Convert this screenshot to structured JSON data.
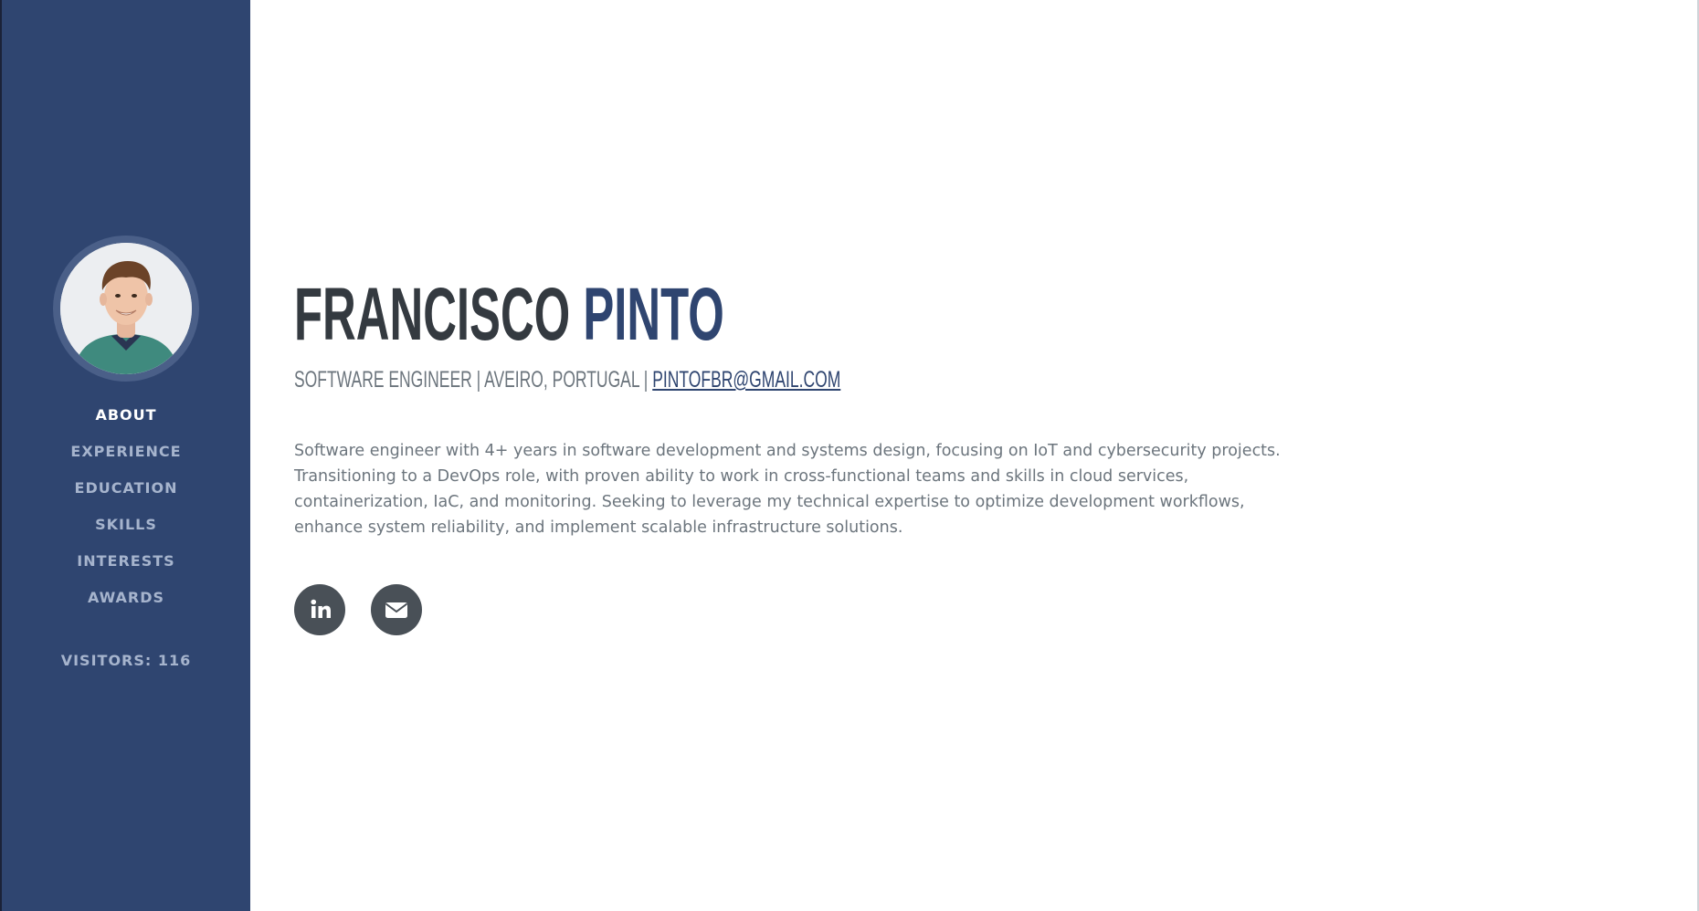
{
  "colors": {
    "sidebar_bg": "#2f4570",
    "primary": "#2f4570",
    "heading": "#343a40",
    "muted_text": "#6c757d",
    "nav_text": "#a6b4cd",
    "nav_active": "#ffffff",
    "social_bg": "#495057"
  },
  "sidebar": {
    "avatar_alt": "profile-photo",
    "nav": [
      {
        "label": "ABOUT",
        "active": true
      },
      {
        "label": "EXPERIENCE",
        "active": false
      },
      {
        "label": "EDUCATION",
        "active": false
      },
      {
        "label": "SKILLS",
        "active": false
      },
      {
        "label": "INTERESTS",
        "active": false
      },
      {
        "label": "AWARDS",
        "active": false
      }
    ],
    "visitors": "VISITORS: 116"
  },
  "about": {
    "first_name": "FRANCISCO",
    "last_name": "PINTO",
    "subheading_text": "SOFTWARE ENGINEER | AVEIRO, PORTUGAL | ",
    "email": "PINTOFBR@GMAIL.COM",
    "summary": "Software engineer with 4+ years in software development and systems design, focusing on IoT and cybersecurity projects. Transitioning to a DevOps role, with proven ability to work in cross-functional teams and skills in cloud services, containerization, IaC, and monitoring. Seeking to leverage my technical expertise to optimize development workflows, enhance system reliability, and implement scalable infrastructure solutions."
  },
  "social": [
    {
      "icon": "linkedin-icon"
    },
    {
      "icon": "envelope-icon"
    }
  ]
}
